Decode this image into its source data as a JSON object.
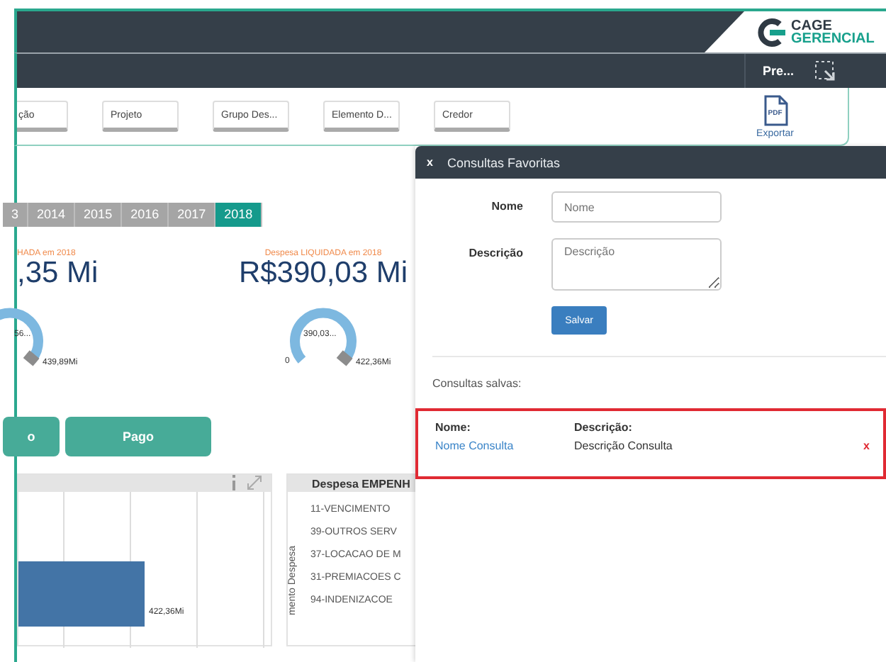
{
  "header": {
    "logo_top": "CAGE",
    "logo_bottom": "GERENCIAL"
  },
  "navbar": {
    "user": "Pre..."
  },
  "filters": [
    {
      "label": "ção"
    },
    {
      "label": "Projeto"
    },
    {
      "label": "Grupo Des..."
    },
    {
      "label": "Elemento D..."
    },
    {
      "label": "Credor"
    }
  ],
  "export": {
    "icon_text": "PDF",
    "label": "Exportar"
  },
  "years": [
    {
      "label": "3",
      "selected": false
    },
    {
      "label": "2014",
      "selected": false
    },
    {
      "label": "2015",
      "selected": false
    },
    {
      "label": "2016",
      "selected": false
    },
    {
      "label": "2017",
      "selected": false
    },
    {
      "label": "2018",
      "selected": true
    }
  ],
  "kpis": [
    {
      "label": "HADA em 2018",
      "value": ",35 Mi",
      "gauge_value": "56...",
      "gauge_max": "439,89Mi"
    },
    {
      "label": "Despesa LIQUIDADA em 2018",
      "value": "R$390,03 Mi",
      "gauge_value": "390,03...",
      "gauge_min": "0",
      "gauge_max": "422,36Mi"
    }
  ],
  "stage_buttons": [
    {
      "label": "o"
    },
    {
      "label": "Pago"
    }
  ],
  "bar_panel": {
    "bar_label": "422,36Mi"
  },
  "list_panel": {
    "title": "Despesa EMPENH",
    "axis_label": "mento Despesa",
    "items": [
      "11-VENCIMENTO",
      "39-OUTROS SERV",
      "37-LOCACAO DE M",
      "31-PREMIACOES C",
      "94-INDENIZACOE"
    ]
  },
  "favorites": {
    "close": "x",
    "title": "Consultas Favoritas",
    "fields": [
      {
        "label": "Nome",
        "placeholder": "Nome",
        "kind": "input"
      },
      {
        "label": "Descrição",
        "placeholder": "Descrição",
        "kind": "textarea"
      }
    ],
    "save": "Salvar",
    "saved_title": "Consultas salvas:",
    "saved": [
      {
        "name_header": "Nome:",
        "desc_header": "Descrição:",
        "name": "Nome Consulta",
        "desc": "Descrição Consulta",
        "remove": "x"
      }
    ]
  }
}
